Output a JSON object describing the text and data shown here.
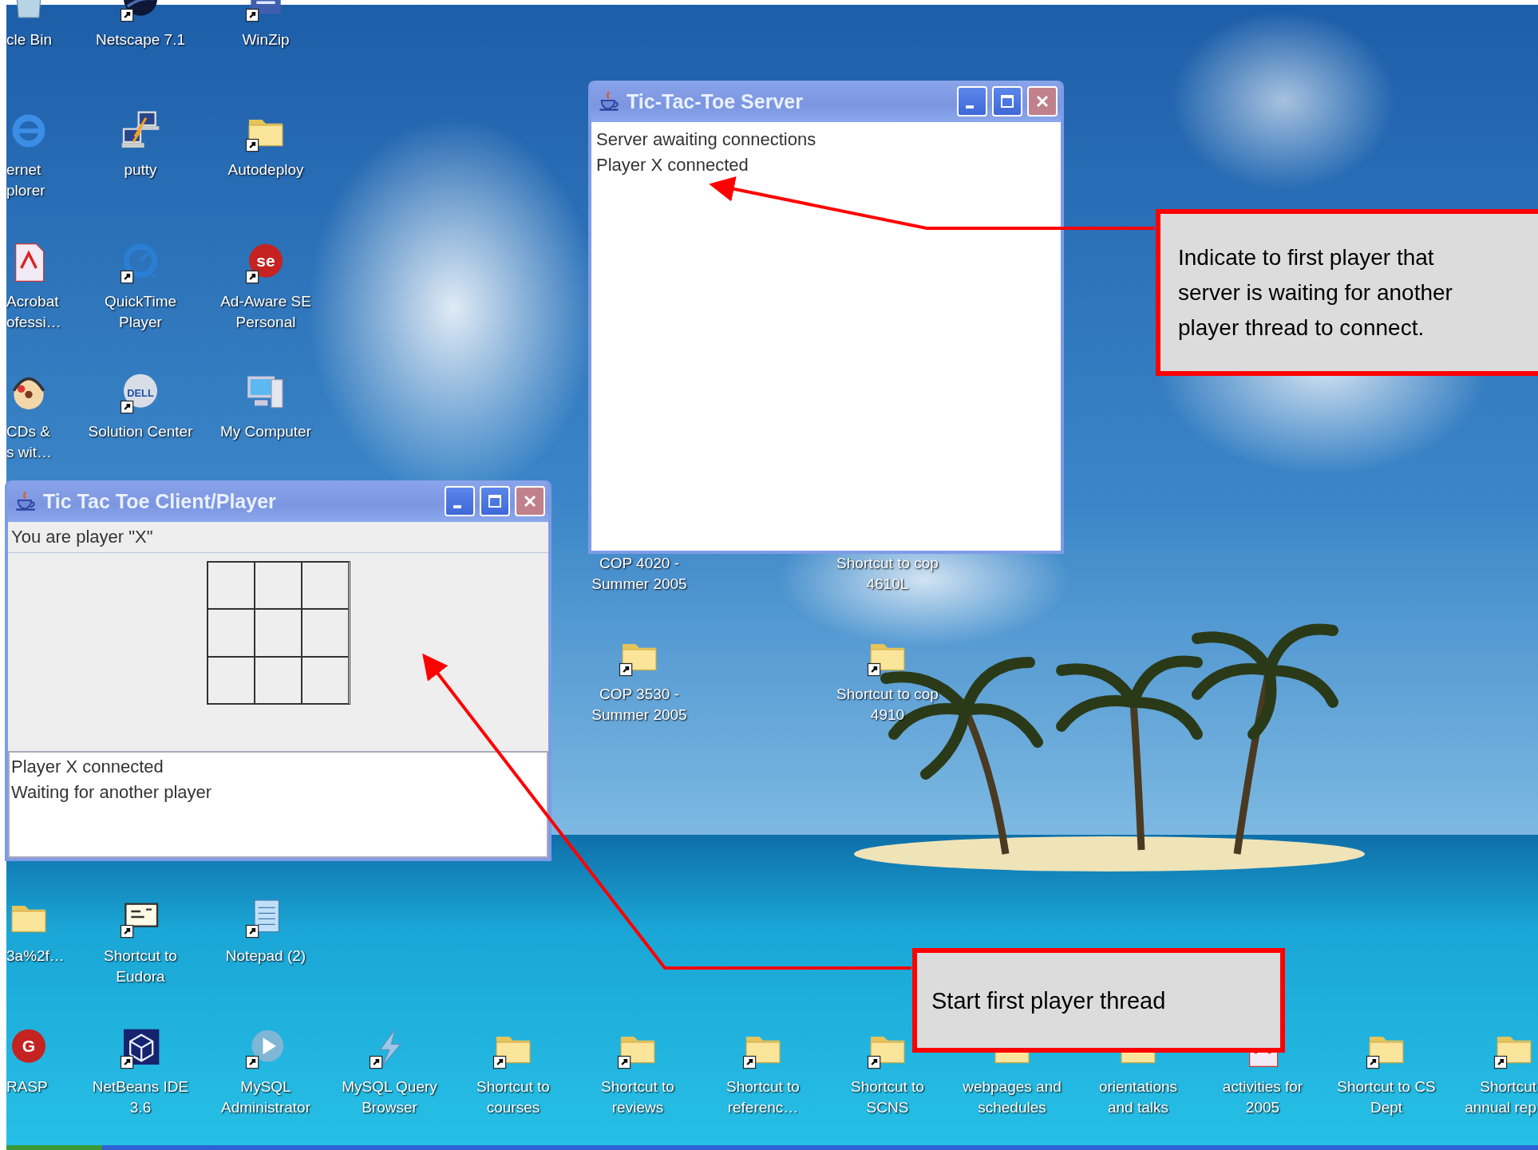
{
  "desktop_icons": [
    {
      "label": "cle Bin",
      "kind": "bin",
      "shortcut": false
    },
    {
      "label": "Netscape 7.1",
      "kind": "sphere",
      "shortcut": true
    },
    {
      "label": "WinZip",
      "kind": "archive",
      "shortcut": true
    },
    {
      "label": "ernet\nplorer",
      "kind": "globe",
      "shortcut": false
    },
    {
      "label": "putty",
      "kind": "network",
      "shortcut": false
    },
    {
      "label": "Autodeploy",
      "kind": "folder",
      "shortcut": true
    },
    {
      "label": "Acrobat\nofessi…",
      "kind": "document",
      "shortcut": false
    },
    {
      "label": "QuickTime\nPlayer",
      "kind": "dial",
      "shortcut": true
    },
    {
      "label": "Ad-Aware SE\nPersonal",
      "kind": "logo",
      "glyph": "se",
      "shortcut": true
    },
    {
      "label": "CDs &\ns wit…",
      "kind": "disc",
      "shortcut": false
    },
    {
      "label": "Solution Center",
      "kind": "logo",
      "glyph": "DELL",
      "shortcut": true
    },
    {
      "label": "My Computer",
      "kind": "computer",
      "shortcut": false
    },
    {
      "label": "COP 4020 -\nSummer 2005"
    },
    {
      "label": "Shortcut to cop\n4610L"
    },
    {
      "label": "COP 3530 -\nSummer 2005",
      "kind": "folder",
      "shortcut": true
    },
    {
      "label": "Shortcut to cop\n4910",
      "kind": "folder",
      "shortcut": true
    },
    {
      "label": "3a%2f…",
      "kind": "folder",
      "shortcut": false
    },
    {
      "label": "Shortcut to\nEudora",
      "kind": "envelope",
      "shortcut": true
    },
    {
      "label": "Notepad (2)",
      "kind": "notepad",
      "shortcut": true
    },
    {
      "label": "RASP",
      "kind": "logo",
      "glyph": "G",
      "shortcut": false
    },
    {
      "label": "NetBeans IDE\n3.6",
      "kind": "cube",
      "shortcut": true
    },
    {
      "label": "MySQL\nAdministrator",
      "kind": "play",
      "shortcut": true
    },
    {
      "label": "MySQL Query\nBrowser",
      "kind": "lightning",
      "shortcut": true
    },
    {
      "label": "Shortcut to\ncourses",
      "kind": "folder",
      "shortcut": true
    },
    {
      "label": "Shortcut to\nreviews",
      "kind": "folder",
      "shortcut": true
    },
    {
      "label": "Shortcut to\nreferenc…",
      "kind": "folder",
      "shortcut": true
    },
    {
      "label": "Shortcut to\nSCNS",
      "kind": "folder",
      "shortcut": true
    },
    {
      "label": "webpages and\nschedules",
      "kind": "folder",
      "shortcut": false
    },
    {
      "label": "orientations\nand talks",
      "kind": "folder",
      "shortcut": false
    },
    {
      "label": "activities for\n2005",
      "kind": "document",
      "shortcut": false
    },
    {
      "label": "Shortcut to CS\nDept",
      "kind": "folder",
      "shortcut": true
    },
    {
      "label": "Shortcut\nannual rep",
      "kind": "folder",
      "shortcut": true
    }
  ],
  "windows": [
    {
      "kind": "server",
      "title": "Tic-Tac-Toe Server",
      "log": [
        "Server awaiting connections",
        "Player X connected"
      ]
    },
    {
      "kind": "client",
      "title": "Tic Tac Toe Client/Player",
      "status": "You are player \"X\"",
      "log": [
        "Player X connected",
        "Waiting for another player"
      ]
    }
  ],
  "callouts": [
    {
      "text": "Indicate to first player that\nserver is waiting for another\nplayer thread to connect."
    },
    {
      "text": "Start first player thread"
    }
  ]
}
